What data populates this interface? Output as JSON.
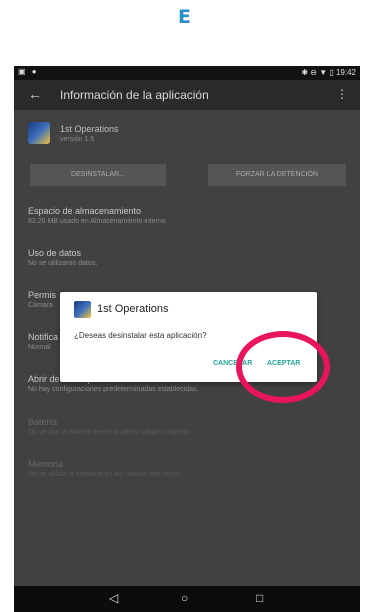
{
  "header_letter": "E",
  "status_bar": {
    "time": "19:42"
  },
  "app_bar": {
    "title": "Información de la aplicación"
  },
  "app": {
    "name": "1st Operations",
    "version": "versión 1.5"
  },
  "buttons": {
    "uninstall": "DESINSTALAR...",
    "force_stop": "FORZAR LA DETENCIÓN"
  },
  "sections": {
    "storage": {
      "title": "Espacio de almacenamiento",
      "subtitle": "83.20 MB usado en Almacenamiento interno"
    },
    "data": {
      "title": "Uso de datos",
      "subtitle": "No se utilizaron datos."
    },
    "permissions": {
      "title": "Permis",
      "subtitle": "Cámara"
    },
    "notifications": {
      "title": "Notifica",
      "subtitle": "Normal"
    },
    "defaults": {
      "title": "Abrir de forma predeterminada",
      "subtitle": "No hay configuraciones predeterminadas establecidas."
    },
    "battery": {
      "title": "Batería",
      "subtitle": "No se usó la batería desde la última carga completa"
    },
    "memory": {
      "title": "Memoria",
      "subtitle": "No se utilizó la memoria en las últimas tres horas"
    }
  },
  "dialog": {
    "title": "1st Operations",
    "message": "¿Deseas desinstalar esta aplicación?",
    "cancel": "CANCELAR",
    "accept": "ACEPTAR"
  },
  "navbar": {
    "back": "◁",
    "home": "○",
    "recents": "□"
  },
  "colors": {
    "accent": "#24a49a",
    "highlight_circle": "#e8145e",
    "header_letter": "#2a8fc9"
  },
  "highlight": "accept-button"
}
